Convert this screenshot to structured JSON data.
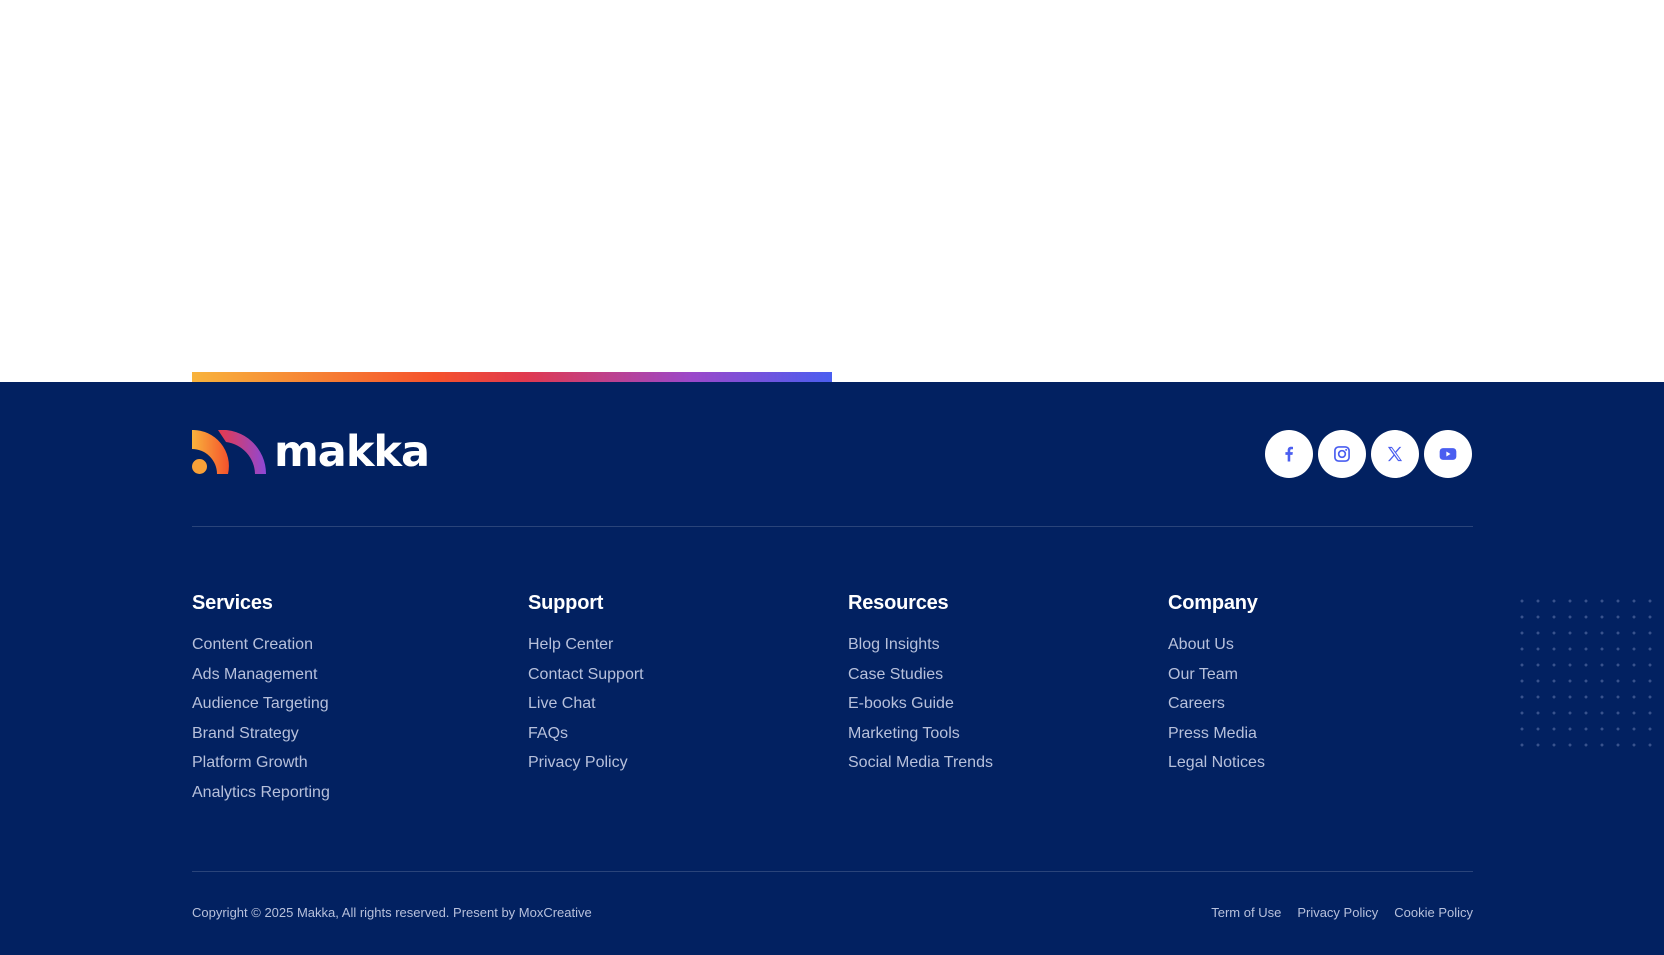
{
  "brand": {
    "name": "makka"
  },
  "social": [
    {
      "name": "facebook-icon",
      "label": "Facebook"
    },
    {
      "name": "instagram-icon",
      "label": "Instagram"
    },
    {
      "name": "x-icon",
      "label": "X"
    },
    {
      "name": "youtube-icon",
      "label": "YouTube"
    }
  ],
  "colors": {
    "footer_bg": "#022161",
    "link": "#b7c0db",
    "icon_accent": "#4a5ef0"
  },
  "columns": [
    {
      "title": "Services",
      "items": [
        "Content Creation",
        "Ads Management",
        "Audience Targeting",
        "Brand Strategy",
        "Platform Growth",
        "Analytics Reporting"
      ]
    },
    {
      "title": "Support",
      "items": [
        "Help Center",
        "Contact Support",
        "Live Chat",
        "FAQs",
        "Privacy Policy"
      ]
    },
    {
      "title": "Resources",
      "items": [
        "Blog Insights",
        "Case Studies",
        "E-books Guide",
        "Marketing Tools",
        "Social Media Trends"
      ]
    },
    {
      "title": "Company",
      "items": [
        "About Us",
        "Our Team",
        "Careers",
        "Press Media",
        "Legal Notices"
      ]
    }
  ],
  "bottom": {
    "copyright": "Copyright © 2025 Makka, All rights reserved. Present by MoxCreative",
    "links": [
      "Term of Use",
      "Privacy Policy",
      "Cookie Policy"
    ]
  }
}
